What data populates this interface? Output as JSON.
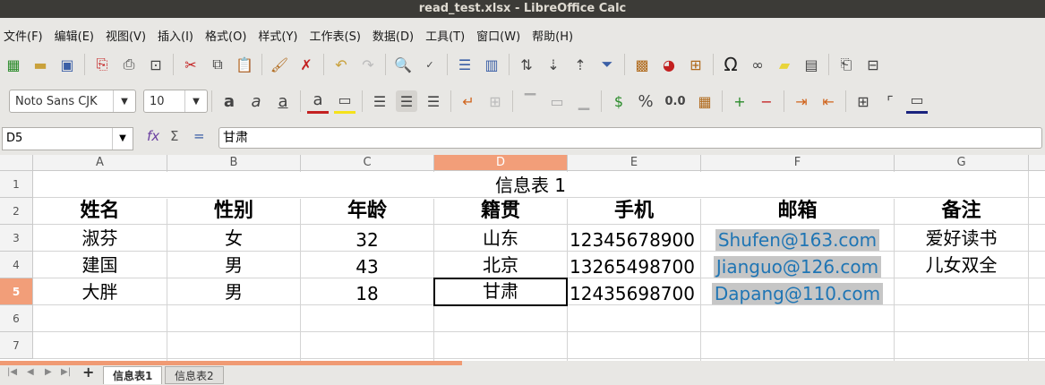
{
  "window": {
    "title": "read_test.xlsx - LibreOffice Calc"
  },
  "menu": [
    "文件(F)",
    "编辑(E)",
    "视图(V)",
    "插入(I)",
    "格式(O)",
    "样式(Y)",
    "工作表(S)",
    "数据(D)",
    "工具(T)",
    "窗口(W)",
    "帮助(H)"
  ],
  "format_bar": {
    "font_name": "Noto Sans CJK",
    "font_size": "10",
    "percent_label": "%",
    "number_label": "0.0"
  },
  "formula_bar": {
    "name_box": "D5",
    "content": "甘肃"
  },
  "columns": [
    "A",
    "B",
    "C",
    "D",
    "E",
    "F",
    "G"
  ],
  "rows": [
    "1",
    "2",
    "3",
    "4",
    "5",
    "6",
    "7"
  ],
  "sheet": {
    "title": "信息表 1",
    "headers": [
      "姓名",
      "性别",
      "年龄",
      "籍贯",
      "手机",
      "邮箱",
      "备注"
    ],
    "records": [
      [
        "淑芬",
        "女",
        "32",
        "山东",
        "12345678900",
        "Shufen@163.com",
        "爱好读书"
      ],
      [
        "建国",
        "男",
        "43",
        "北京",
        "13265498700",
        "Jianguo@126.com",
        "儿女双全"
      ],
      [
        "大胖",
        "男",
        "18",
        "甘肃",
        "12435698700",
        "Dapang@110.com",
        ""
      ]
    ]
  },
  "tabs": [
    "信息表1",
    "信息表2"
  ],
  "colors": {
    "accent": "#f29e79",
    "link": "#1f75b4"
  }
}
